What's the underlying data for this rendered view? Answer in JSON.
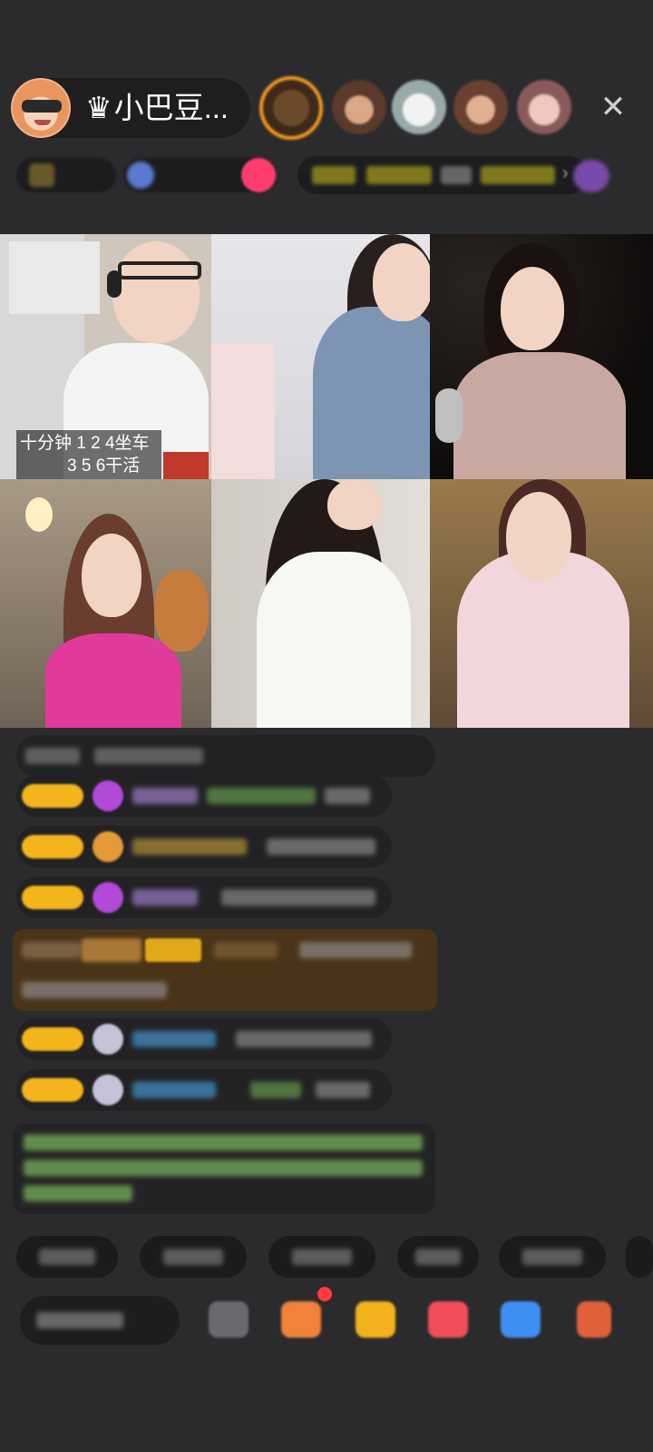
{
  "host": {
    "name": "小巴豆...",
    "crown_icon": "crown-icon",
    "avatar_icon": "host-avatar"
  },
  "viewers": [
    "viewer-avatar-1",
    "viewer-avatar-2",
    "viewer-avatar-3",
    "viewer-avatar-4",
    "viewer-avatar-5"
  ],
  "close_icon": "close-icon",
  "video_grid": {
    "tile1_caption_line1": "十分钟 1 2 4坐车",
    "tile1_caption_line2": "3 5 6干活"
  },
  "colors": {
    "background": "#2b2b2d",
    "badge_gold": "#f3b51b",
    "gift_banner": "#4a3418",
    "system_text_green": "#8bd36b",
    "username_purple": "#b48be0",
    "username_blue": "#4aa8e8"
  }
}
